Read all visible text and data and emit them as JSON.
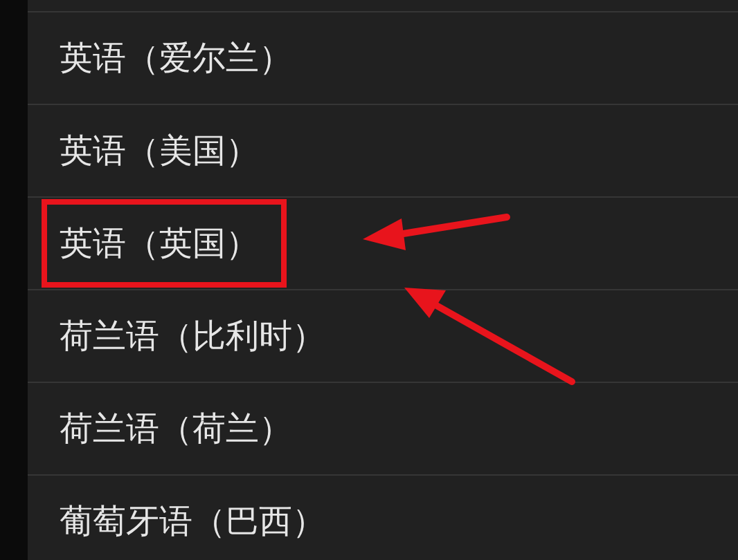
{
  "languages": [
    {
      "label": "英语（爱尔兰）",
      "highlighted": false
    },
    {
      "label": "英语（美国）",
      "highlighted": false
    },
    {
      "label": "英语（英国）",
      "highlighted": true
    },
    {
      "label": "荷兰语（比利时）",
      "highlighted": false
    },
    {
      "label": "荷兰语（荷兰）",
      "highlighted": false
    },
    {
      "label": "葡萄牙语（巴西）",
      "highlighted": false
    }
  ]
}
